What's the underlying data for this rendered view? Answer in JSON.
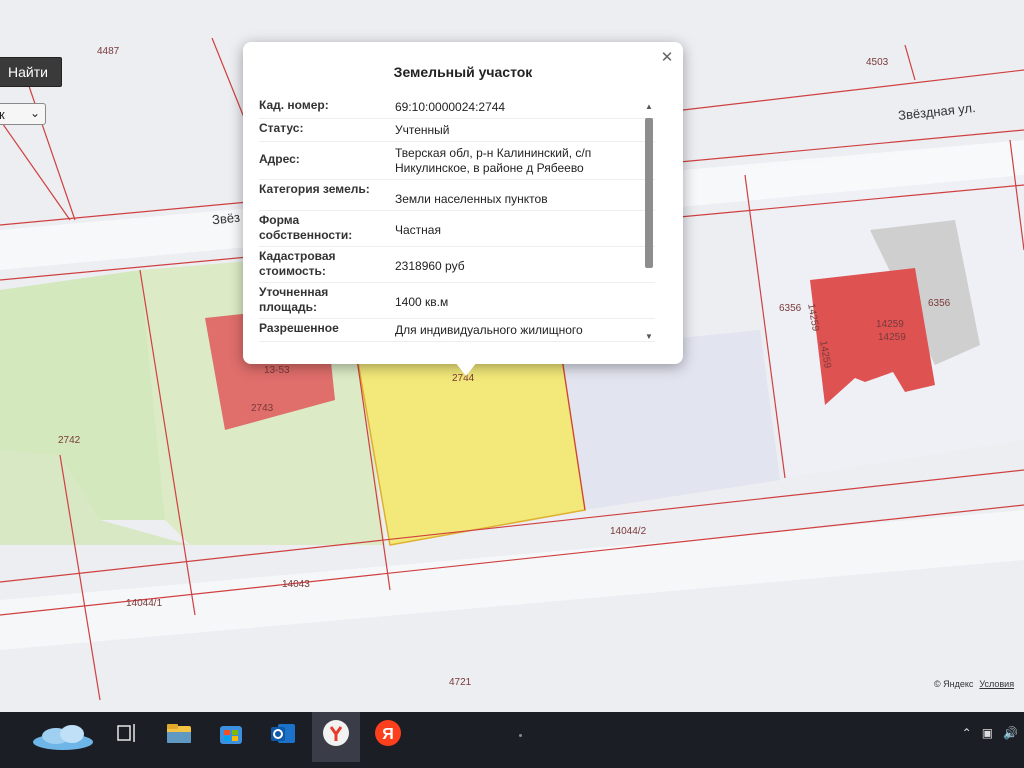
{
  "ui": {
    "search_button": "Найти",
    "filter_select_value": "к"
  },
  "popup": {
    "title": "Земельный участок",
    "close_icon": "close-icon",
    "rows": [
      {
        "label": "Кад. номер:",
        "value": "69:10:0000024:2744"
      },
      {
        "label": "Статус:",
        "value": "Учтенный"
      },
      {
        "label": "Адрес:",
        "value": "Тверская обл, р-н Калининский, с/п Никулинское, в районе д Рябеево"
      },
      {
        "label": "Категория земель:",
        "value": "Земли населенных пунктов"
      },
      {
        "label": "Форма собственности:",
        "value": "Частная"
      },
      {
        "label": "Кадастровая стоимость:",
        "value": "2318960 руб"
      },
      {
        "label": "Уточненная площадь:",
        "value": "1400 кв.м"
      },
      {
        "label": "Разрешенное",
        "value": "Для индивидуального жилищного"
      }
    ]
  },
  "map": {
    "streets": [
      "Звёздная ул.",
      "Звёз"
    ],
    "plot_labels": {
      "p4487": "4487",
      "p4503": "4503",
      "p6356a": "6356",
      "p6356b": "6356",
      "p14259a": "14259",
      "p14259b": "14259",
      "p14259c": "14259",
      "p14259d": "14259",
      "p1353": "13-53",
      "p2743": "2743",
      "p2744": "2744",
      "p2742": "2742",
      "p14044_2": "14044/2",
      "p14043": "14043",
      "p14044_1": "14044/1",
      "p4721": "4721"
    },
    "attribution": "© Яндекс",
    "terms_link": "Условия"
  },
  "colors": {
    "selected_plot": "#f2e97a",
    "building": "#e06060",
    "green_area": "#cfe7b7",
    "boundary": "#d04040"
  },
  "taskbar": {
    "icons": [
      "weather-icon",
      "task-view-icon",
      "file-explorer-icon",
      "store-icon",
      "outlook-icon",
      "yandex-browser-icon",
      "yandex-icon"
    ]
  }
}
